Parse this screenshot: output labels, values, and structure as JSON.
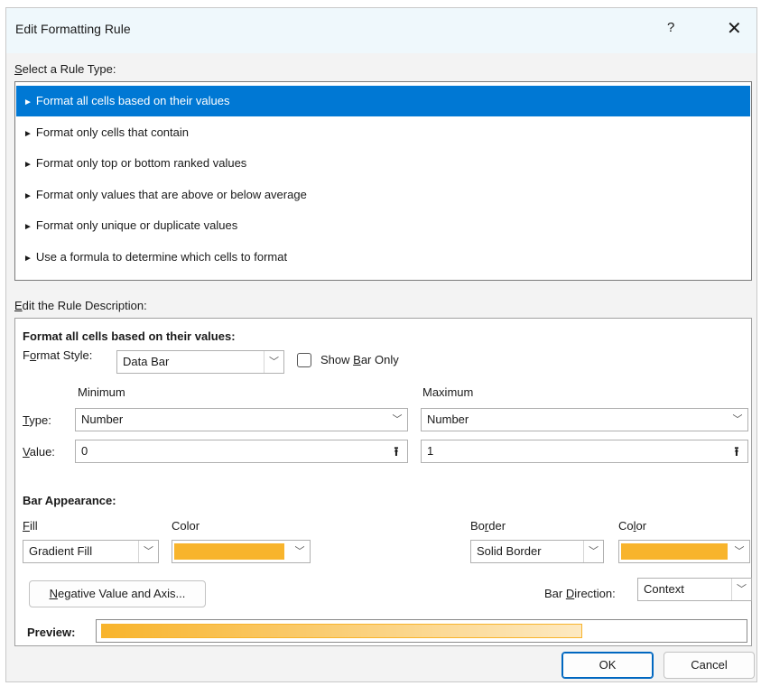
{
  "title": "Edit Formatting Rule",
  "help_label": "?",
  "close_label": "✕",
  "select_rule_type_label": "Select a Rule Type:",
  "rule_types": [
    {
      "label": "Format all cells based on their values",
      "selected": true
    },
    {
      "label": "Format only cells that contain",
      "selected": false
    },
    {
      "label": "Format only top or bottom ranked values",
      "selected": false
    },
    {
      "label": "Format only values that are above or below average",
      "selected": false
    },
    {
      "label": "Format only unique or duplicate values",
      "selected": false
    },
    {
      "label": "Use a formula to determine which cells to format",
      "selected": false
    }
  ],
  "rule_arrow": "►",
  "edit_description_label": "Edit the Rule Description:",
  "description": {
    "heading": "Format all cells based on their values:",
    "format_style_label": "Format Style:",
    "format_style_value": "Data Bar",
    "show_bar_only_label": "Show Bar Only",
    "show_bar_only_checked": false,
    "minimum_label": "Minimum",
    "maximum_label": "Maximum",
    "type_label": "Type:",
    "value_label": "Value:",
    "min_type": "Number",
    "max_type": "Number",
    "min_value": "0",
    "max_value": "1",
    "ref_button_icon": "⭱",
    "bar_appearance_label": "Bar Appearance:",
    "fill_label": "Fill",
    "fill_color_label": "Color",
    "fill_value": "Gradient Fill",
    "fill_color": "#f8b42c",
    "border_label": "Border",
    "border_color_label": "Color",
    "border_value": "Solid Border",
    "border_color": "#f8b42c",
    "negative_axis_button": "Negative Value and Axis...",
    "bar_direction_label": "Bar Direction:",
    "bar_direction_value": "Context",
    "preview_label": "Preview:",
    "preview_fill_fraction": 0.75
  },
  "ok_label": "OK",
  "cancel_label": "Cancel",
  "dropdown_icon": "﹀",
  "colors": {
    "accent": "#0078d4",
    "bar_color": "#f8b42c"
  }
}
